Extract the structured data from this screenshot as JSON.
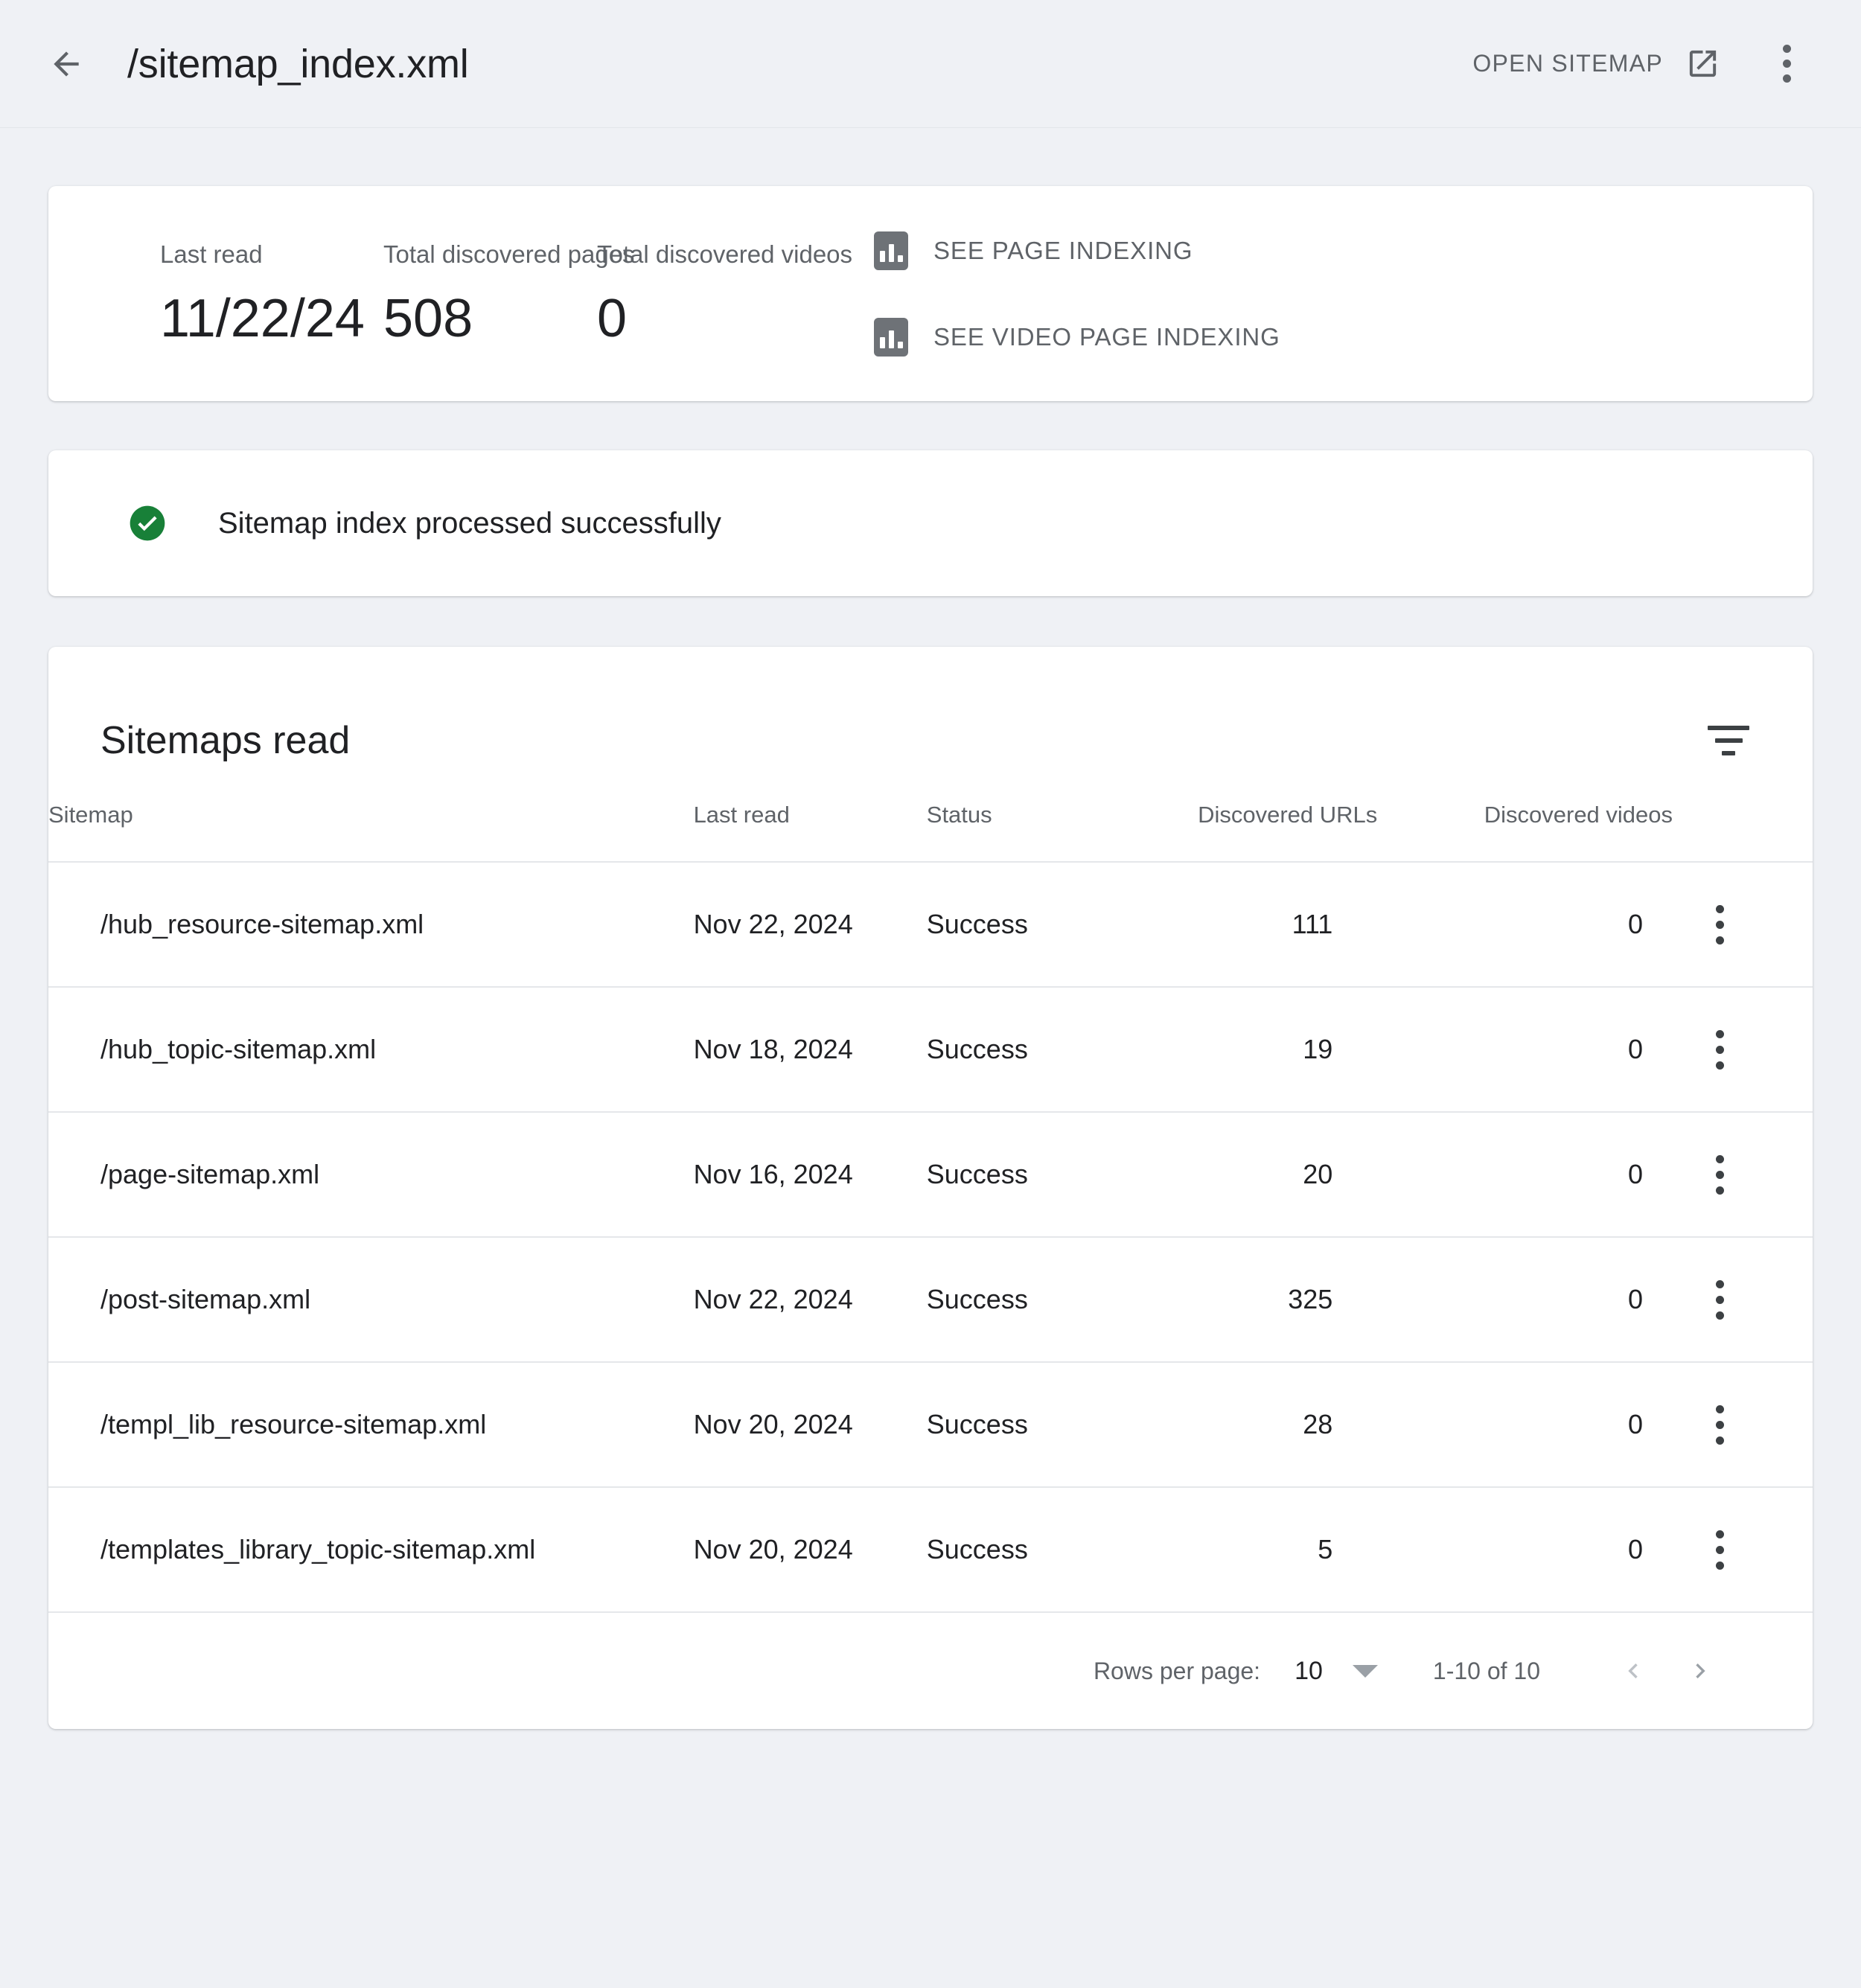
{
  "appbar": {
    "back_icon": "arrow-left-icon",
    "title": "/sitemap_index.xml",
    "open_sitemap_label": "OPEN SITEMAP",
    "open_sitemap_icon": "open-in-new-icon",
    "more_icon": "more-vert-icon"
  },
  "summary": {
    "metrics": [
      {
        "label": "Last read",
        "value": "11/22/24"
      },
      {
        "label": "Total discovered pages",
        "value": "508"
      },
      {
        "label": "Total discovered videos",
        "value": "0"
      }
    ],
    "links": [
      {
        "label": "SEE PAGE INDEXING",
        "icon": "bar-chart-icon"
      },
      {
        "label": "SEE VIDEO PAGE INDEXING",
        "icon": "bar-chart-icon"
      }
    ]
  },
  "status": {
    "icon": "check-circle-icon",
    "color": "#188038",
    "message": "Sitemap index processed successfully"
  },
  "table": {
    "title": "Sitemaps read",
    "filter_icon": "filter-list-icon",
    "columns": [
      "Sitemap",
      "Last read",
      "Status",
      "Discovered URLs",
      "Discovered videos"
    ],
    "rows": [
      {
        "sitemap": "/hub_resource-sitemap.xml",
        "last_read": "Nov 22, 2024",
        "status": "Success",
        "urls": "111",
        "videos": "0"
      },
      {
        "sitemap": "/hub_topic-sitemap.xml",
        "last_read": "Nov 18, 2024",
        "status": "Success",
        "urls": "19",
        "videos": "0"
      },
      {
        "sitemap": "/page-sitemap.xml",
        "last_read": "Nov 16, 2024",
        "status": "Success",
        "urls": "20",
        "videos": "0"
      },
      {
        "sitemap": "/post-sitemap.xml",
        "last_read": "Nov 22, 2024",
        "status": "Success",
        "urls": "325",
        "videos": "0"
      },
      {
        "sitemap": "/templ_lib_resource-sitemap.xml",
        "last_read": "Nov 20, 2024",
        "status": "Success",
        "urls": "28",
        "videos": "0"
      },
      {
        "sitemap": "/templates_library_topic-sitemap.xml",
        "last_read": "Nov 20, 2024",
        "status": "Success",
        "urls": "5",
        "videos": "0"
      }
    ],
    "row_menu_icon": "more-vert-icon"
  },
  "pagination": {
    "rows_per_page_label": "Rows per page:",
    "rows_per_page_value": "10",
    "range_label": "1-10 of 10",
    "prev_icon": "chevron-left-icon",
    "next_icon": "chevron-right-icon"
  }
}
